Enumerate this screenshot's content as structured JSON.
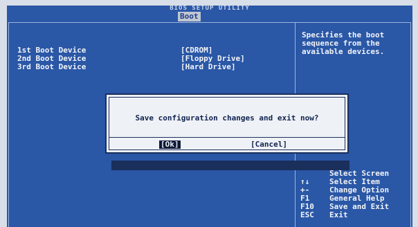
{
  "header": {
    "title": "BIOS SETUP UTILITY",
    "active_tab": "Boot"
  },
  "boot": {
    "items": [
      {
        "label": "1st Boot Device",
        "value": "[CDROM]"
      },
      {
        "label": "2nd Boot Device",
        "value": "[Floppy Drive]"
      },
      {
        "label": "3rd Boot Device",
        "value": "[Hard Drive]"
      }
    ]
  },
  "help": {
    "text": "Specifies the boot\nsequence from the\navailable devices."
  },
  "keys": [
    {
      "key": "",
      "action": "Select Screen"
    },
    {
      "key": "↑↓",
      "action": "Select Item"
    },
    {
      "key": "+-",
      "action": "Change Option"
    },
    {
      "key": "F1",
      "action": "General Help"
    },
    {
      "key": "F10",
      "action": "Save and Exit"
    },
    {
      "key": "ESC",
      "action": "Exit"
    }
  ],
  "dialog": {
    "message": "Save configuration changes and exit now?",
    "ok_label": "[Ok]",
    "cancel_label": "[Cancel]"
  },
  "colors": {
    "background": "#2a57a6",
    "dialog_bg": "#eef1f6",
    "dialog_text": "#10244f",
    "selected_bg": "#0f1a33"
  }
}
